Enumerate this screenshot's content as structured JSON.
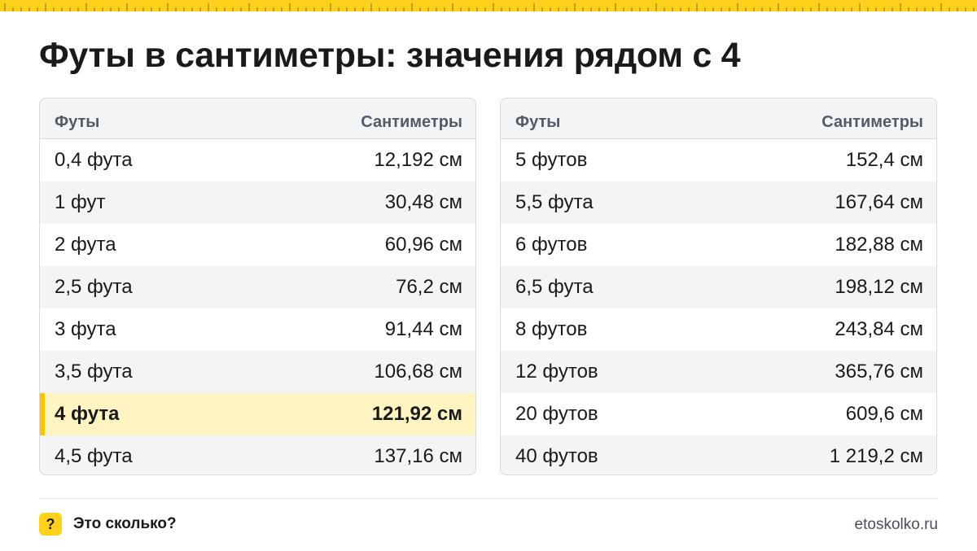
{
  "title": "Футы в сантиметры: значения рядом с 4",
  "colors": {
    "accent": "#FFD11A",
    "highlight_bg": "#FFF4C2",
    "highlight_bar": "#FFC600",
    "zebra": "#f3f4f6"
  },
  "tables": [
    {
      "headers": {
        "feet": "Футы",
        "cm": "Сантиметры"
      },
      "rows": [
        {
          "feet": "0,4 фута",
          "cm": "12,192 см"
        },
        {
          "feet": "1 фут",
          "cm": "30,48 см"
        },
        {
          "feet": "2 фута",
          "cm": "60,96 см"
        },
        {
          "feet": "2,5 фута",
          "cm": "76,2 см"
        },
        {
          "feet": "3 фута",
          "cm": "91,44 см"
        },
        {
          "feet": "3,5 фута",
          "cm": "106,68 см"
        },
        {
          "feet": "4 фута",
          "cm": "121,92 см",
          "highlight": true
        },
        {
          "feet": "4,5 фута",
          "cm": "137,16 см"
        }
      ]
    },
    {
      "headers": {
        "feet": "Футы",
        "cm": "Сантиметры"
      },
      "rows": [
        {
          "feet": "5 футов",
          "cm": "152,4 см"
        },
        {
          "feet": "5,5 фута",
          "cm": "167,64 см"
        },
        {
          "feet": "6 футов",
          "cm": "182,88 см"
        },
        {
          "feet": "6,5 фута",
          "cm": "198,12 см"
        },
        {
          "feet": "8 футов",
          "cm": "243,84 см"
        },
        {
          "feet": "12 футов",
          "cm": "365,76 см"
        },
        {
          "feet": "20 футов",
          "cm": "609,6 см"
        },
        {
          "feet": "40 футов",
          "cm": "1 219,2 см"
        }
      ]
    }
  ],
  "footer": {
    "badge": "?",
    "brand": "Это сколько?",
    "site": "etoskolko.ru",
    "badge_icon": "question-mark-icon"
  }
}
